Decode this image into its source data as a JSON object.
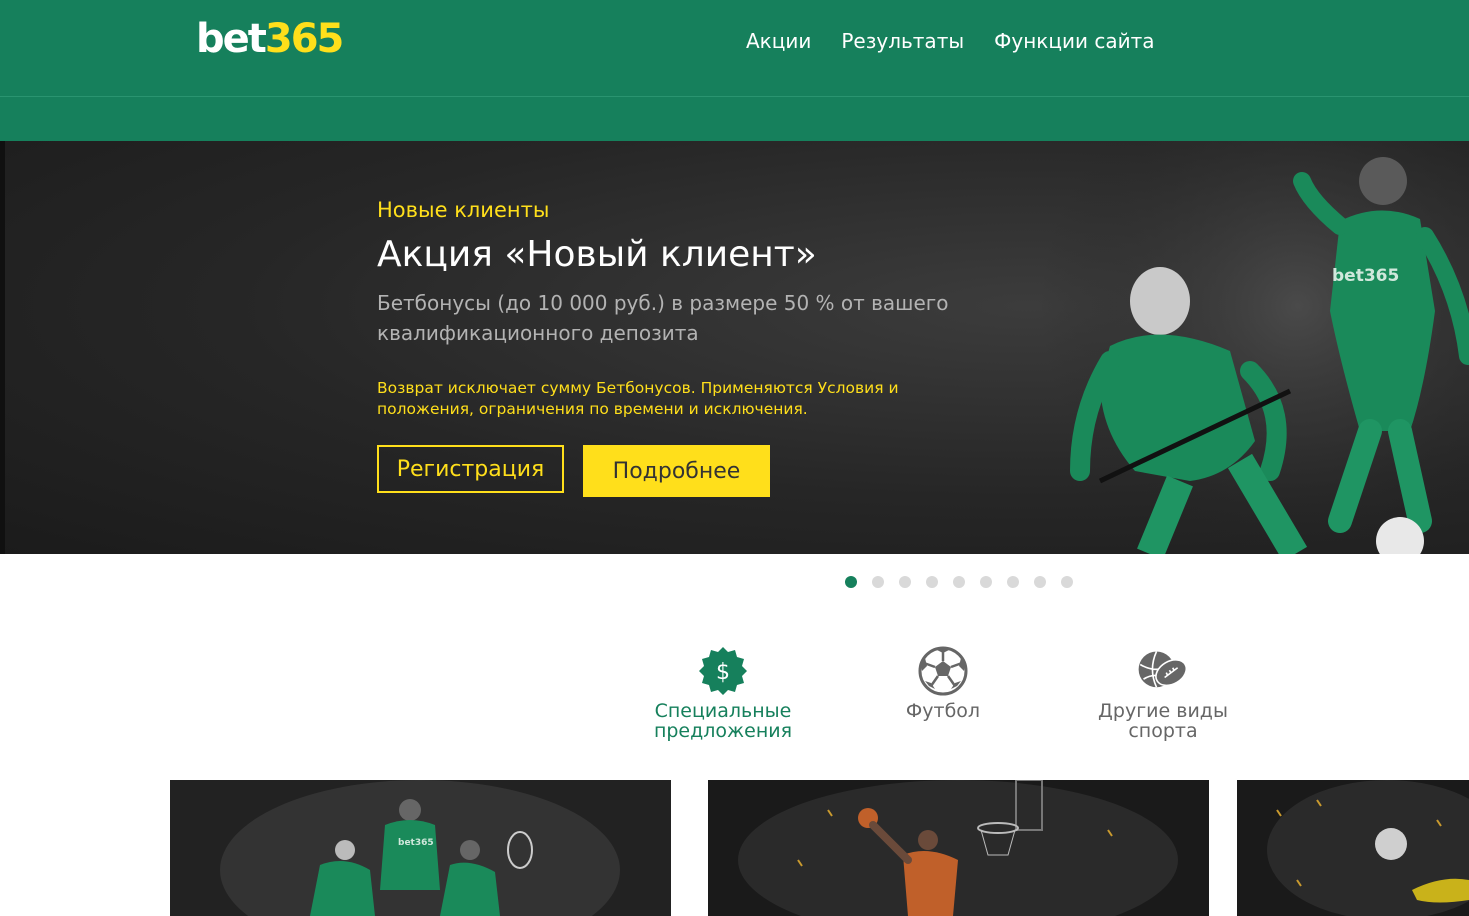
{
  "header": {
    "logo": {
      "part1": "bet",
      "part2": "365"
    },
    "nav": [
      {
        "label": "Акции"
      },
      {
        "label": "Результаты"
      },
      {
        "label": "Функции сайта"
      }
    ]
  },
  "hero": {
    "eyebrow": "Новые клиенты",
    "title": "Акция «Новый клиент»",
    "description": "Бетбонусы (до 10 000 руб.) в размере 50 % от вашего квалификационного депозита",
    "note": "Возврат исключает сумму Бетбонусов. Применяются Условия и положения, ограничения по времени и исключения.",
    "register_label": "Регистрация",
    "more_label": "Подробнее",
    "jersey_text": "bet365"
  },
  "carousel": {
    "total_slides": 9,
    "active_index": 0
  },
  "categories": [
    {
      "label": "Специальные предложения",
      "icon": "dollar-badge-icon",
      "active": true
    },
    {
      "label": "Футбол",
      "icon": "soccer-ball-icon",
      "active": false
    },
    {
      "label": "Другие виды спорта",
      "icon": "sports-balls-icon",
      "active": false
    }
  ],
  "tiles": [
    {
      "name": "multi-sport-promo-tile",
      "jersey_text": "bet365"
    },
    {
      "name": "basketball-promo-tile"
    },
    {
      "name": "football-promo-tile"
    }
  ],
  "colors": {
    "brand_green": "#16805c",
    "brand_yellow": "#ffdf1b",
    "hero_bg": "#262626"
  }
}
